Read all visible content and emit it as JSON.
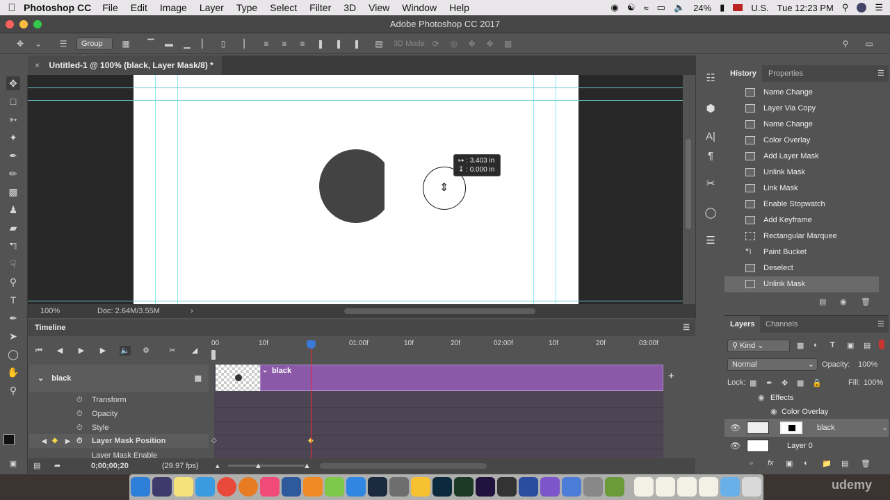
{
  "menubar": {
    "app_name": "Photoshop CC",
    "items": [
      "File",
      "Edit",
      "Image",
      "Layer",
      "Type",
      "Select",
      "Filter",
      "3D",
      "View",
      "Window",
      "Help"
    ],
    "battery": "24%",
    "input_source": "U.S.",
    "clock": "Tue 12:23 PM"
  },
  "window": {
    "title": "Adobe Photoshop CC 2017"
  },
  "options_bar": {
    "auto_select_value": "Group",
    "mode_3d_label": "3D Mode:"
  },
  "document": {
    "tab_title": "Untitled-1 @ 100% (black, Layer Mask/8) *",
    "close_glyph": "×"
  },
  "canvas": {
    "tooltip_line1": "↦ : 3.403 in",
    "tooltip_line2": "↧ : 0.000 in"
  },
  "status_bar": {
    "zoom": "100%",
    "doc_size": "Doc: 2.64M/3.55M",
    "arrow": "›"
  },
  "timeline": {
    "panel_title": "Timeline",
    "ruler_labels": [
      "00",
      "10f",
      "01:00f",
      "10f",
      "20f",
      "02:00f",
      "10f",
      "20f",
      "03:00f"
    ],
    "layer_name": "black",
    "clip_name": "black",
    "properties": [
      "Transform",
      "Opacity",
      "Style",
      "Layer Mask Position",
      "Layer Mask Enable"
    ],
    "current_time": "0;00;00;20",
    "fps": "(29.97 fps)",
    "add_glyph": "+"
  },
  "history": {
    "tab_history": "History",
    "tab_properties": "Properties",
    "items": [
      "Name Change",
      "Layer Via Copy",
      "Name Change",
      "Color Overlay",
      "Add Layer Mask",
      "Unlink Mask",
      "Link Mask",
      "Enable Stopwatch",
      "Add Keyframe",
      "Rectangular Marquee",
      "Paint Bucket",
      "Deselect",
      "Unlink Mask"
    ]
  },
  "layers": {
    "tab_layers": "Layers",
    "tab_channels": "Channels",
    "filter_kind": "Kind",
    "blend_mode": "Normal",
    "opacity_label": "Opacity:",
    "opacity_value": "100%",
    "lock_label": "Lock:",
    "fill_label": "Fill:",
    "fill_value": "100%",
    "effects_label": "Effects",
    "color_overlay_label": "Color Overlay",
    "layer_black": "black",
    "layer_0": "Layer 0"
  },
  "dock": {
    "watermark": "udemy"
  },
  "colors": {
    "accent_blue": "#3a7ad6",
    "clip_purple": "#8a5aa8",
    "guide_cyan": "#8ee6ef",
    "playhead_red": "#e22233"
  }
}
